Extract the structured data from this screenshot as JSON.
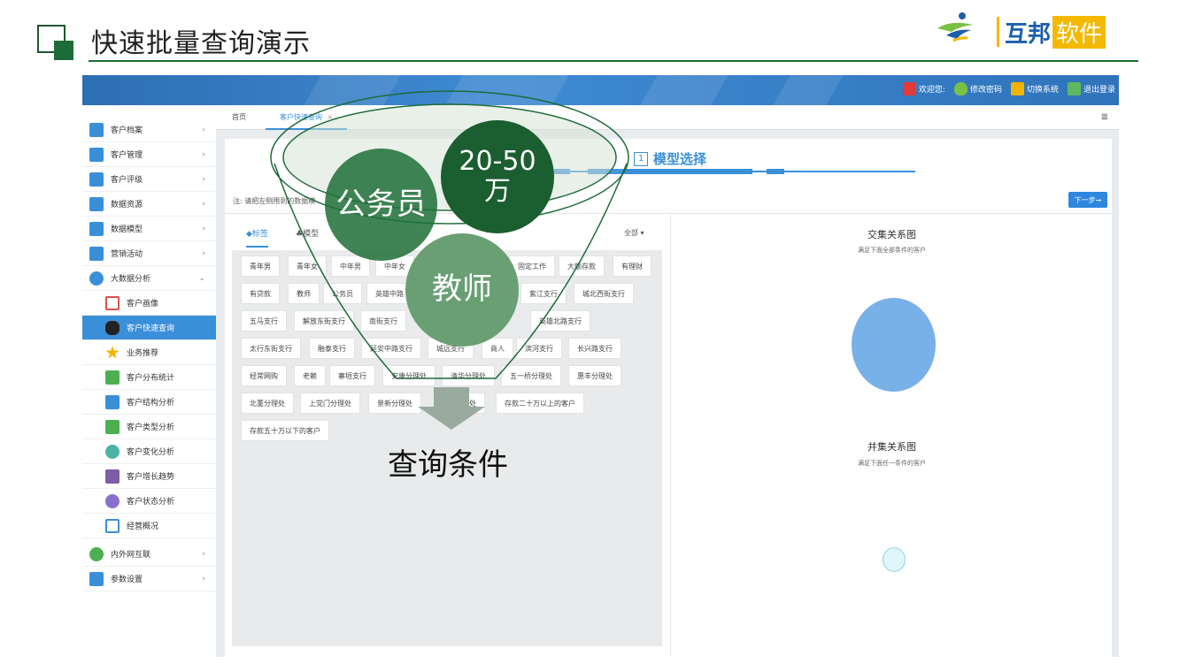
{
  "slide": {
    "title": "快速批量查询演示",
    "logo": {
      "text_a": "互邦",
      "text_b": "软件"
    }
  },
  "topbar": {
    "actions": [
      {
        "label": "欢迎您:",
        "icon": "user-icon",
        "color": "#e03a3a"
      },
      {
        "label": "修改密码",
        "icon": "shield-icon",
        "color": "#7ac143"
      },
      {
        "label": "切换系统",
        "icon": "switch-icon",
        "color": "#f0b400"
      },
      {
        "label": "退出登录",
        "icon": "exit-flag-icon",
        "color": "#5fb85f"
      }
    ]
  },
  "sidebar": {
    "items": [
      {
        "label": "客户档案",
        "icon": "archive-icon",
        "color": "#3a8fd9",
        "chevron": "›"
      },
      {
        "label": "客户管理",
        "icon": "user-card-icon",
        "color": "#3a8fd9",
        "chevron": "›"
      },
      {
        "label": "客户评级",
        "icon": "rating-icon",
        "color": "#3a8fd9",
        "chevron": "›"
      },
      {
        "label": "数据资源",
        "icon": "database-icon",
        "color": "#3a8fd9",
        "chevron": "›"
      },
      {
        "label": "数据模型",
        "icon": "bar-chart-icon",
        "color": "#3a8fd9",
        "chevron": "›"
      },
      {
        "label": "营销活动",
        "icon": "megaphone-icon",
        "color": "#3a8fd9",
        "chevron": "›"
      },
      {
        "label": "大数据分析",
        "icon": "pie-chart-icon",
        "color": "#3a8fd9",
        "chevron": "⌄"
      }
    ],
    "sub_items": [
      {
        "label": "客户画像",
        "icon": "portrait-icon",
        "color": "#d9534f",
        "active": false
      },
      {
        "label": "客户快速查询",
        "icon": "binoculars-icon",
        "color": "#222",
        "active": true
      },
      {
        "label": "业务推荐",
        "icon": "star-icon",
        "color": "#f0b400",
        "active": false
      },
      {
        "label": "客户分布统计",
        "icon": "map-pin-icon",
        "color": "#4caf50",
        "active": false
      },
      {
        "label": "客户结构分析",
        "icon": "structure-icon",
        "color": "#3a8fd9",
        "active": false
      },
      {
        "label": "客户类型分析",
        "icon": "chat-icon",
        "color": "#4caf50",
        "active": false
      },
      {
        "label": "客户变化分析",
        "icon": "wave-icon",
        "color": "#4bb3a6",
        "active": false
      },
      {
        "label": "客户增长趋势",
        "icon": "growth-icon",
        "color": "#7b5ea7",
        "active": false
      },
      {
        "label": "客户状态分析",
        "icon": "status-icon",
        "color": "#8a6fd1",
        "active": false
      },
      {
        "label": "经营概况",
        "icon": "calendar-icon",
        "color": "#3a8fd9",
        "active": false
      }
    ],
    "bottom_items": [
      {
        "label": "内外网互联",
        "icon": "globe-icon",
        "color": "#4caf50",
        "chevron": "›"
      },
      {
        "label": "参数设置",
        "icon": "settings-icon",
        "color": "#3a8fd9",
        "chevron": "›"
      }
    ]
  },
  "tabs": {
    "home": "首页",
    "current": "客户快速查询",
    "close": "×",
    "menu": "≣"
  },
  "content": {
    "step_number": "1",
    "step_label": "模型选择",
    "note": "注: 请把左侧用到的数据模",
    "next_button": "下一步➞",
    "left_tabs": {
      "labels": "◆标签",
      "models": "♣模型",
      "all": "全部 ▾"
    },
    "chips": [
      [
        "青年男",
        "青年女",
        "中年男",
        "中年女",
        "",
        "固定工作",
        "大额存款",
        "有理财"
      ],
      [
        "有贷款",
        "教师",
        "公务员",
        "英雄中路",
        "",
        "紫江支行",
        "城北西街支行"
      ],
      [
        "五马支行",
        "解放东街支行",
        "南街支行",
        "",
        "英雄北路支行"
      ],
      [
        "太行东街支行",
        "融泰支行",
        "延安中路支行",
        "城远支行",
        "商人",
        "滨河支行",
        "长兴路支行"
      ],
      [
        "经常网购",
        "老赖",
        "寨垣支行",
        "安康分理处",
        "清华分理处",
        "五一桥分理处",
        "惠丰分理处"
      ],
      [
        "北董分理处",
        "上党门分理处",
        "景新分理处",
        "理处",
        "存款二十万以上的客户"
      ],
      [
        "存款五十万以下的客户"
      ]
    ],
    "intersection_title": "交集关系图",
    "intersection_sub": "满足下面全部条件的客户",
    "union_title": "并集关系图",
    "union_sub": "满足下面任一条件的客户"
  },
  "overlay": {
    "circle_a": "公务员",
    "circle_b_line1": "20-50",
    "circle_b_line2": "万",
    "circle_c": "教师",
    "caption": "查询条件"
  }
}
